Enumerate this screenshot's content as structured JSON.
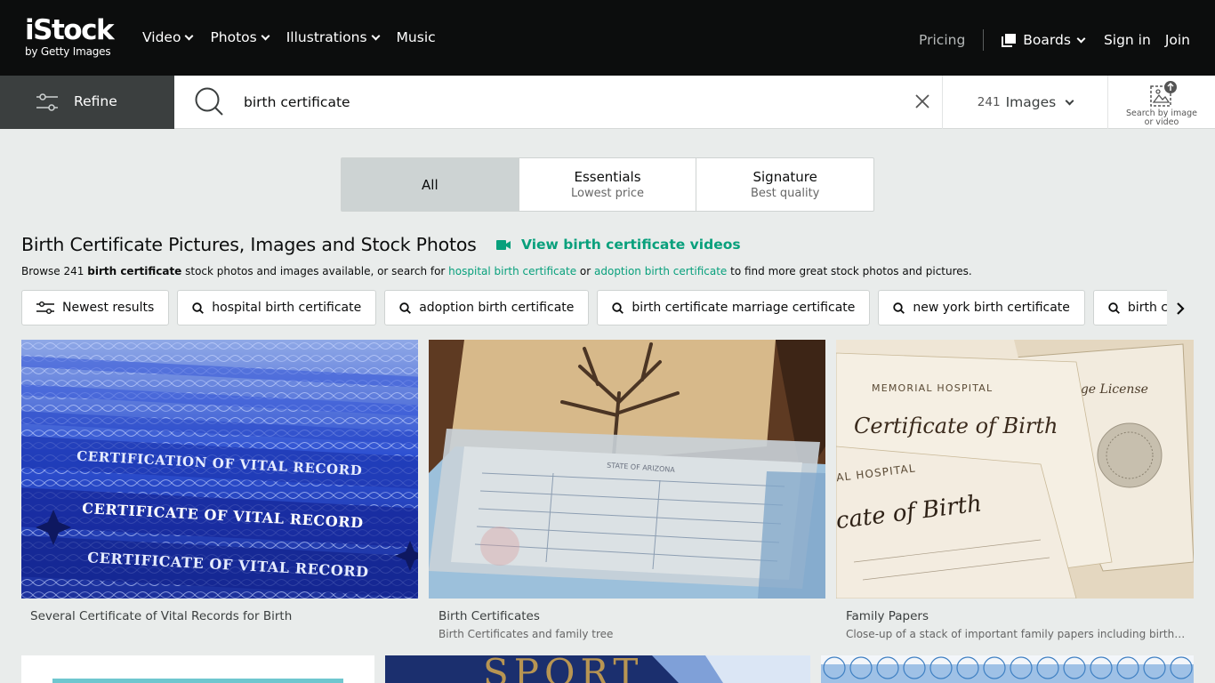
{
  "header": {
    "logo_main": "iStock",
    "logo_sub": "by Getty Images",
    "nav": [
      {
        "label": "Video",
        "has_menu": true
      },
      {
        "label": "Photos",
        "has_menu": true
      },
      {
        "label": "Illustrations",
        "has_menu": true
      },
      {
        "label": "Music",
        "has_menu": false
      }
    ],
    "pricing": "Pricing",
    "boards": "Boards",
    "sign_in": "Sign in",
    "join": "Join"
  },
  "search": {
    "refine_label": "Refine",
    "query": "birth certificate",
    "count_number": "241",
    "count_label": "Images",
    "by_image_line1": "Search by image",
    "by_image_line2": "or video"
  },
  "segments": [
    {
      "title": "All",
      "subtitle": "",
      "active": true
    },
    {
      "title": "Essentials",
      "subtitle": "Lowest price",
      "active": false
    },
    {
      "title": "Signature",
      "subtitle": "Best quality",
      "active": false
    }
  ],
  "results": {
    "title": "Birth Certificate Pictures, Images and Stock Photos",
    "videos_link": "View birth certificate videos",
    "desc_prefix": "Browse 241 ",
    "desc_bold": "birth certificate",
    "desc_mid": " stock photos and images available, or search for ",
    "desc_link1": "hospital birth certificate",
    "desc_or": " or ",
    "desc_link2": "adoption birth certificate",
    "desc_suffix": " to find more great stock photos and pictures."
  },
  "chips": [
    {
      "label": "Newest results",
      "icon": "sliders-icon"
    },
    {
      "label": "hospital birth certificate",
      "icon": "search-icon"
    },
    {
      "label": "adoption birth certificate",
      "icon": "search-icon"
    },
    {
      "label": "birth certificate marriage certificate",
      "icon": "search-icon"
    },
    {
      "label": "new york birth certificate",
      "icon": "search-icon"
    },
    {
      "label": "birth certificate",
      "icon": "search-icon"
    }
  ],
  "images": [
    {
      "title": "Several Certificate of Vital Records for Birth",
      "subtitle": "",
      "text_lines": [
        "CERTIFICATION OF VITAL RECORD",
        "CERTIFICATE OF VITAL RECORD",
        "CERTIFICATE OF VITAL RECORD"
      ]
    },
    {
      "title": "Birth Certificates",
      "subtitle": "Birth Certificates and family tree",
      "text_lines": [
        "STATE OF ARIZONA"
      ]
    },
    {
      "title": "Family Papers",
      "subtitle": "Close-up of a stack of important family papers including birth cer...",
      "text_lines": [
        "MEMORIAL HOSPITAL",
        "Certificate of Birth",
        "AL HOSPITAL",
        "cate of Birth",
        "iage License"
      ]
    }
  ],
  "row2": {
    "passport_text": "SPORT"
  },
  "colors": {
    "header_bg": "#0c0d0d",
    "accent_green": "#08a07c",
    "refine_bg": "#3b3f3f",
    "page_bg": "#e9eceb"
  }
}
